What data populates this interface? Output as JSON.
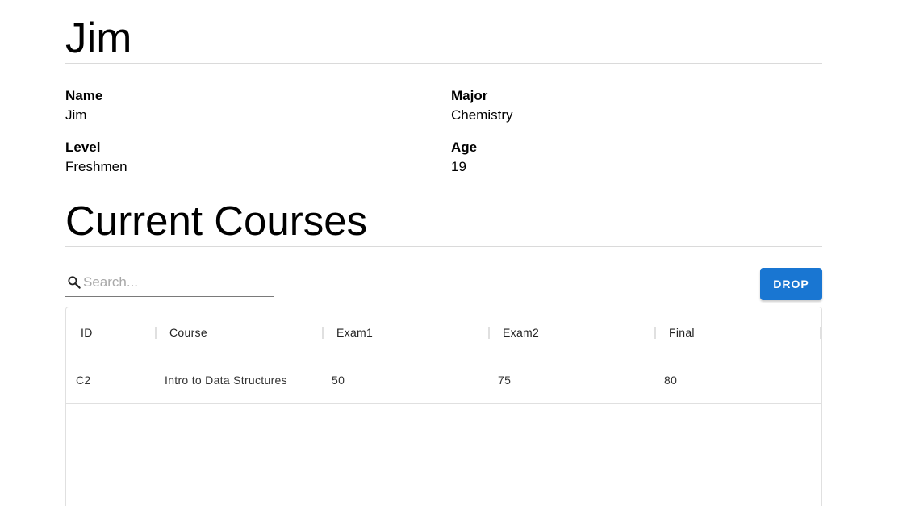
{
  "student": {
    "title": "Jim",
    "fields": {
      "name_label": "Name",
      "name_value": "Jim",
      "major_label": "Major",
      "major_value": "Chemistry",
      "level_label": "Level",
      "level_value": "Freshmen",
      "age_label": "Age",
      "age_value": "19"
    }
  },
  "courses": {
    "title": "Current Courses",
    "search": {
      "placeholder": "Search...",
      "value": "",
      "icon": "search-icon"
    },
    "drop_label": "DROP",
    "accent_color": "#1976d2",
    "columns": [
      "ID",
      "Course",
      "Exam1",
      "Exam2",
      "Final"
    ],
    "rows": [
      [
        "C2",
        "Intro to Data Structures",
        "50",
        "75",
        "80"
      ]
    ]
  }
}
